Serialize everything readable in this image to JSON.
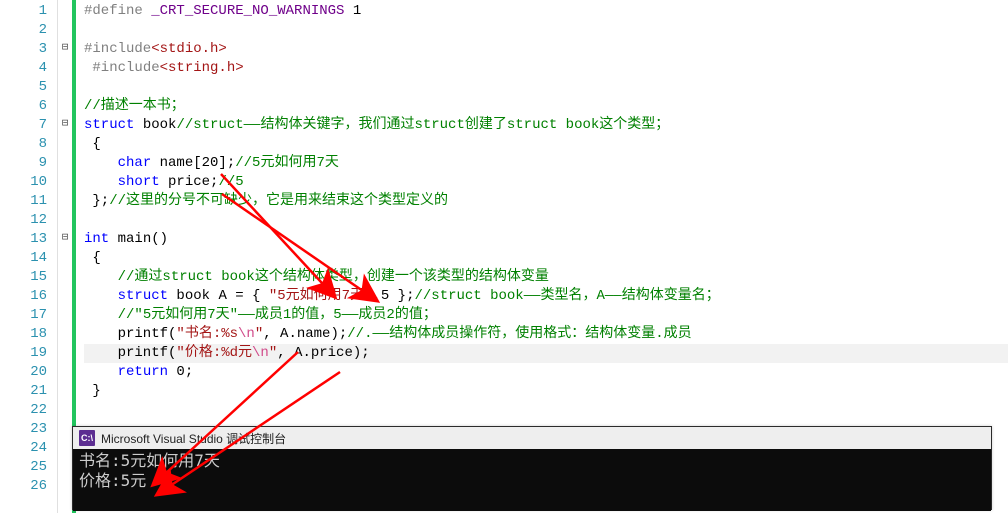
{
  "gutter": {
    "start": 1,
    "end": 26
  },
  "folds": [
    {
      "ln": 3,
      "sym": "⊟"
    },
    {
      "ln": 7,
      "sym": "⊟"
    },
    {
      "ln": 13,
      "sym": "⊟"
    }
  ],
  "code": [
    {
      "t": [
        {
          "c": "kw-gray",
          "s": "#define"
        },
        {
          "c": "plain",
          "s": " "
        },
        {
          "c": "purple",
          "s": "_CRT_SECURE_NO_WARNINGS"
        },
        {
          "c": "plain",
          "s": " 1"
        }
      ]
    },
    {
      "t": []
    },
    {
      "t": [
        {
          "c": "kw-gray",
          "s": "#include"
        },
        {
          "c": "str-red",
          "s": "<stdio.h>"
        }
      ]
    },
    {
      "t": [
        {
          "c": "plain",
          "s": " "
        },
        {
          "c": "kw-gray",
          "s": "#include"
        },
        {
          "c": "str-red",
          "s": "<string.h>"
        }
      ]
    },
    {
      "t": []
    },
    {
      "t": [
        {
          "c": "comment",
          "s": "//描述一本书；"
        }
      ]
    },
    {
      "t": [
        {
          "c": "kw-blue",
          "s": "struct"
        },
        {
          "c": "plain",
          "s": " book"
        },
        {
          "c": "comment",
          "s": "//struct——结构体关键字，我们通过struct创建了struct book这个类型；"
        }
      ]
    },
    {
      "t": [
        {
          "c": "plain",
          "s": " {"
        }
      ]
    },
    {
      "t": [
        {
          "c": "plain",
          "s": "    "
        },
        {
          "c": "kw-blue",
          "s": "char"
        },
        {
          "c": "plain",
          "s": " name[20];"
        },
        {
          "c": "comment",
          "s": "//5元如何用7天"
        }
      ]
    },
    {
      "t": [
        {
          "c": "plain",
          "s": "    "
        },
        {
          "c": "kw-blue",
          "s": "short"
        },
        {
          "c": "plain",
          "s": " price;"
        },
        {
          "c": "comment",
          "s": "//5"
        }
      ]
    },
    {
      "t": [
        {
          "c": "plain",
          "s": " };"
        },
        {
          "c": "comment",
          "s": "//这里的分号不可缺少，它是用来结束这个类型定义的"
        }
      ]
    },
    {
      "t": []
    },
    {
      "t": [
        {
          "c": "kw-blue",
          "s": "int"
        },
        {
          "c": "plain",
          "s": " main()"
        }
      ]
    },
    {
      "t": [
        {
          "c": "plain",
          "s": " {"
        }
      ]
    },
    {
      "t": [
        {
          "c": "plain",
          "s": "    "
        },
        {
          "c": "comment",
          "s": "//通过struct book这个结构体类型，创建一个该类型的结构体变量"
        }
      ]
    },
    {
      "t": [
        {
          "c": "plain",
          "s": "    "
        },
        {
          "c": "kw-blue",
          "s": "struct"
        },
        {
          "c": "plain",
          "s": " book A = { "
        },
        {
          "c": "str-red",
          "s": "\"5元如何用7天\""
        },
        {
          "c": "plain",
          "s": ",5 };"
        },
        {
          "c": "comment",
          "s": "//struct book——类型名，A——结构体变量名；"
        }
      ]
    },
    {
      "t": [
        {
          "c": "plain",
          "s": "    "
        },
        {
          "c": "comment",
          "s": "//\"5元如何用7天\"——成员1的值，5——成员2的值；"
        }
      ]
    },
    {
      "t": [
        {
          "c": "plain",
          "s": "    printf("
        },
        {
          "c": "str-red",
          "s": "\"书名:%s"
        },
        {
          "c": "str-pink",
          "s": "\\n"
        },
        {
          "c": "str-red",
          "s": "\""
        },
        {
          "c": "plain",
          "s": ", A.name);"
        },
        {
          "c": "comment",
          "s": "//.——结构体成员操作符，使用格式：结构体变量.成员"
        }
      ]
    },
    {
      "t": [
        {
          "c": "plain",
          "s": "    printf("
        },
        {
          "c": "str-red",
          "s": "\"价格:%d元"
        },
        {
          "c": "str-pink",
          "s": "\\n"
        },
        {
          "c": "str-red",
          "s": "\""
        },
        {
          "c": "plain",
          "s": ", A.price);"
        }
      ],
      "hl": true
    },
    {
      "t": [
        {
          "c": "plain",
          "s": "    "
        },
        {
          "c": "kw-blue",
          "s": "return"
        },
        {
          "c": "plain",
          "s": " 0;"
        }
      ]
    },
    {
      "t": [
        {
          "c": "plain",
          "s": " }"
        }
      ]
    },
    {
      "t": []
    },
    {
      "t": []
    },
    {
      "t": []
    },
    {
      "t": []
    },
    {
      "t": []
    }
  ],
  "console": {
    "icon": "C:\\",
    "title": "Microsoft Visual Studio 调试控制台",
    "lines": [
      "书名:5元如何用7天",
      "价格:5元"
    ]
  }
}
